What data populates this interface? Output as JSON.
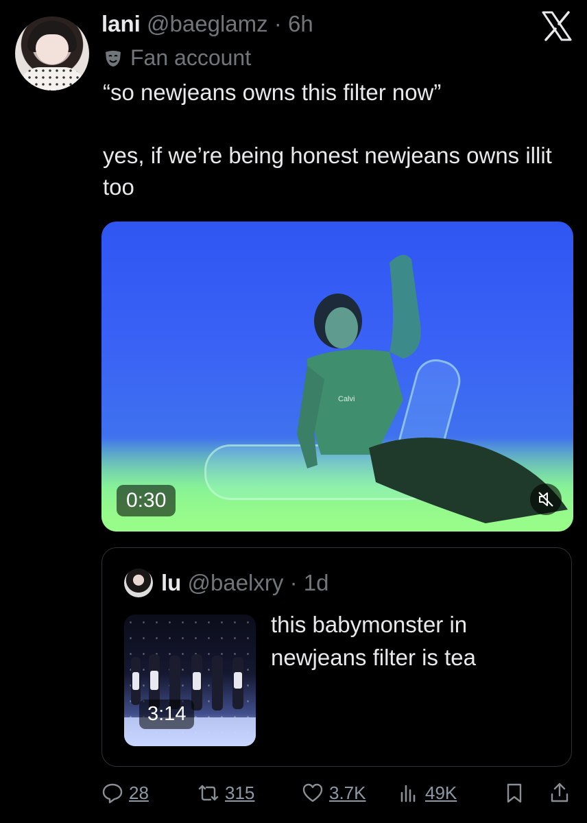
{
  "author": {
    "name": "lani",
    "handle": "@baeglamz",
    "separator": "·",
    "time": "6h",
    "label": "Fan account"
  },
  "tweet": {
    "text": "“so newjeans owns this filter now”\n\nyes, if we’re being honest newjeans owns illit too"
  },
  "media": {
    "duration": "0:30",
    "mute_icon": "speaker-muted-icon",
    "shirt_text": "Calvi"
  },
  "quote": {
    "name": "lu",
    "handle": "@baelxry",
    "separator": "·",
    "time": "1d",
    "text": "this babymonster in newjeans filter is tea",
    "thumb_duration": "3:14"
  },
  "actions": {
    "replies": "28",
    "reposts": "315",
    "likes": "3.7K",
    "views": "49K"
  },
  "colors": {
    "background": "#000000",
    "text": "#e7e9ea",
    "muted": "#71767b",
    "border": "#2f3336"
  }
}
